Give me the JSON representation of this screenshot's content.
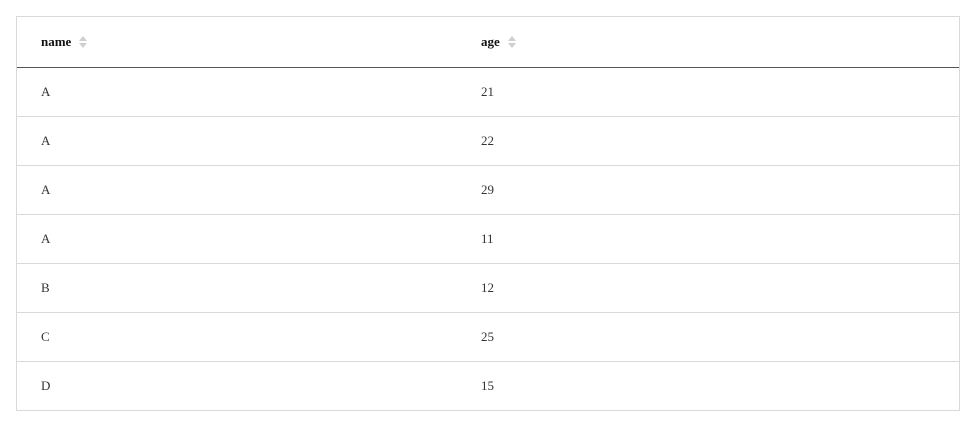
{
  "table": {
    "columns": [
      {
        "label": "name"
      },
      {
        "label": "age"
      }
    ],
    "rows": [
      {
        "name": "A",
        "age": "21"
      },
      {
        "name": "A",
        "age": "22"
      },
      {
        "name": "A",
        "age": "29"
      },
      {
        "name": "A",
        "age": "11"
      },
      {
        "name": "B",
        "age": "12"
      },
      {
        "name": "C",
        "age": "25"
      },
      {
        "name": "D",
        "age": "15"
      }
    ],
    "sort_icon": "sort-caret-icon"
  }
}
